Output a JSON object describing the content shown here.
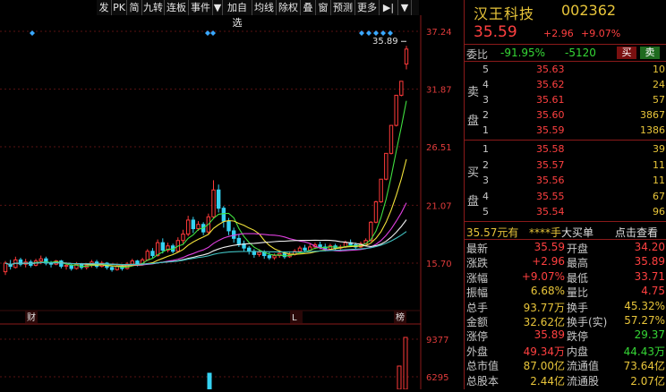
{
  "toolbar": {
    "items": [
      "发",
      "PK",
      "简",
      "九转",
      "连板",
      "事件",
      "▼",
      "加自选",
      "均线",
      "除权",
      "叠",
      "窗",
      "预测",
      "更多",
      "▶|",
      "▼"
    ]
  },
  "chart": {
    "price_ticks": [
      "37.24",
      "31.87",
      "26.51",
      "21.07",
      "15.70"
    ],
    "high_marker": "35.89",
    "bottom_labels": [
      "财",
      "L",
      "榜"
    ],
    "volume_ticks": [
      "9377",
      "6295"
    ]
  },
  "quote": {
    "name": "汉王科技",
    "code": "002362",
    "price": "35.59",
    "change": "+2.96",
    "change_pct": "+9.07%",
    "weibi_label": "委比",
    "weibi_pct": "-91.95%",
    "weicha": "-5120",
    "buy_button": "买",
    "sell_button": "卖"
  },
  "order_book": {
    "sell_side_chars": [
      "卖",
      "盘"
    ],
    "buy_side_chars": [
      "买",
      "盘"
    ],
    "asks": [
      {
        "level": "5",
        "price": "35.63",
        "vol": "10"
      },
      {
        "level": "4",
        "price": "35.62",
        "vol": "24"
      },
      {
        "level": "3",
        "price": "35.61",
        "vol": "57"
      },
      {
        "level": "2",
        "price": "35.60",
        "vol": "3867"
      },
      {
        "level": "1",
        "price": "35.59",
        "vol": "1386"
      }
    ],
    "bids": [
      {
        "level": "1",
        "price": "35.58",
        "vol": "39"
      },
      {
        "level": "2",
        "price": "35.57",
        "vol": "11"
      },
      {
        "level": "3",
        "price": "35.56",
        "vol": "11"
      },
      {
        "level": "4",
        "price": "35.55",
        "vol": "67"
      },
      {
        "level": "5",
        "price": "35.54",
        "vol": "96"
      }
    ]
  },
  "big_order": {
    "price": "35.57元有",
    "amount": "****手",
    "label": "大买单",
    "link": "点击查看"
  },
  "stats": [
    {
      "k1": "最新",
      "v1": "35.59",
      "c1": "r",
      "k2": "开盘",
      "v2": "34.20",
      "c2": "r"
    },
    {
      "k1": "涨跌",
      "v1": "+2.96",
      "c1": "r",
      "k2": "最高",
      "v2": "35.89",
      "c2": "r"
    },
    {
      "k1": "涨幅",
      "v1": "+9.07%",
      "c1": "r",
      "k2": "最低",
      "v2": "33.71",
      "c2": "r"
    },
    {
      "k1": "振幅",
      "v1": "6.68%",
      "c1": "y",
      "k2": "量比",
      "v2": "4.75",
      "c2": "r"
    },
    {
      "k1": "总手",
      "v1": "93.77万",
      "c1": "y",
      "k2": "换手",
      "v2": "45.32%",
      "c2": "y"
    },
    {
      "k1": "金额",
      "v1": "32.62亿",
      "c1": "y",
      "k2": "换手(实)",
      "v2": "57.27%",
      "c2": "y"
    },
    {
      "k1": "涨停",
      "v1": "35.89",
      "c1": "r",
      "k2": "跌停",
      "v2": "29.37",
      "c2": "g"
    },
    {
      "k1": "外盘",
      "v1": "49.34万",
      "c1": "r",
      "k2": "内盘",
      "v2": "44.43万",
      "c2": "g"
    },
    {
      "k1": "总市值",
      "v1": "87.00亿",
      "c1": "y",
      "k2": "流通值",
      "v2": "73.64亿",
      "c2": "y"
    },
    {
      "k1": "总股本",
      "v1": "2.44亿",
      "c1": "y",
      "k2": "流通股",
      "v2": "2.07亿",
      "c2": "y"
    }
  ],
  "colors": {
    "up": "#ff4040",
    "down": "#35d635",
    "yellow": "#e8c53a",
    "ma_white": "#f0f0f0",
    "ma_yellow": "#f2e23a",
    "ma_magenta": "#e040e0",
    "ma_green": "#40e040",
    "ma_cyan": "#40c0c0",
    "candle_up": "#ff3a3a",
    "candle_down": "#35d2f2"
  }
}
